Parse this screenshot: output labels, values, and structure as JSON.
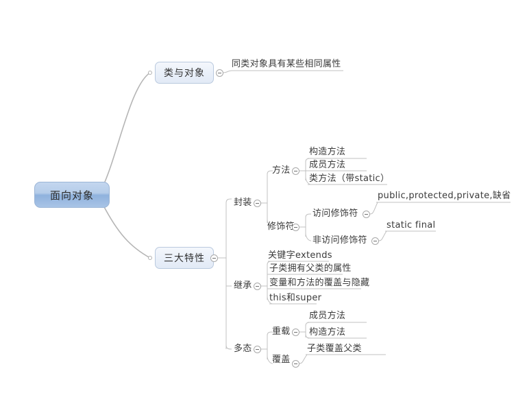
{
  "mindmap": {
    "root": {
      "label": "面向对象",
      "color": "#8fb2dd"
    },
    "branches": [
      {
        "id": "class-object",
        "label": "类与对象",
        "type": "box",
        "children": [
          {
            "id": "same-class-attrs",
            "label": "同类对象具有某些相同属性",
            "type": "leaf"
          }
        ]
      },
      {
        "id": "three-features",
        "label": "三大特性",
        "type": "box",
        "children": [
          {
            "id": "encapsulation",
            "label": "封装",
            "type": "text",
            "children": [
              {
                "id": "methods",
                "label": "方法",
                "type": "text",
                "children": [
                  {
                    "id": "constructor-method",
                    "label": "构造方法",
                    "type": "leaf"
                  },
                  {
                    "id": "member-method",
                    "label": "成员方法",
                    "type": "leaf"
                  },
                  {
                    "id": "class-method",
                    "label": "类方法（带static）",
                    "type": "leaf"
                  }
                ]
              },
              {
                "id": "modifiers",
                "label": "修饰符",
                "type": "text",
                "children": [
                  {
                    "id": "access-modifier",
                    "label": "访问修饰符",
                    "type": "text",
                    "children": [
                      {
                        "id": "access-list",
                        "label": "public,protected,private,缺省",
                        "type": "leaf"
                      }
                    ]
                  },
                  {
                    "id": "non-access-modifier",
                    "label": "非访问修饰符",
                    "type": "text",
                    "children": [
                      {
                        "id": "static-final",
                        "label": "static final",
                        "type": "leaf"
                      }
                    ]
                  }
                ]
              }
            ]
          },
          {
            "id": "inheritance",
            "label": "继承",
            "type": "text",
            "children": [
              {
                "id": "keyword-extends",
                "label": "关键字extends",
                "type": "leaf"
              },
              {
                "id": "subclass-owns-parent",
                "label": "子类拥有父类的属性",
                "type": "leaf"
              },
              {
                "id": "override-hide",
                "label": "变量和方法的覆盖与隐藏",
                "type": "leaf"
              },
              {
                "id": "this-and-super",
                "label": "this和super",
                "type": "leaf"
              }
            ]
          },
          {
            "id": "polymorphism",
            "label": "多态",
            "type": "text",
            "children": [
              {
                "id": "overload",
                "label": "重载",
                "type": "text",
                "children": [
                  {
                    "id": "overload-member-method",
                    "label": "成员方法",
                    "type": "leaf"
                  },
                  {
                    "id": "overload-constructor-method",
                    "label": "构造方法",
                    "type": "leaf"
                  }
                ]
              },
              {
                "id": "override",
                "label": "覆盖",
                "type": "text",
                "children": [
                  {
                    "id": "subclass-overrides-parent",
                    "label": "子类覆盖父类",
                    "type": "leaf"
                  }
                ]
              }
            ]
          }
        ]
      }
    ]
  }
}
